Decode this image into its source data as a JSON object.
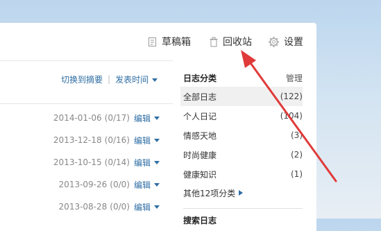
{
  "toolbar": {
    "drafts_label": "草稿箱",
    "recycle_label": "回收站",
    "settings_label": "设置"
  },
  "sort_bar": {
    "switch_label": "切换到摘要",
    "separator": "|",
    "sort_label": "发表时间"
  },
  "posts": [
    {
      "date": "2014-01-06",
      "stats": "(0/17)",
      "edit": "编辑"
    },
    {
      "date": "2013-12-18",
      "stats": "(0/16)",
      "edit": "编辑"
    },
    {
      "date": "2013-10-15",
      "stats": "(0/14)",
      "edit": "编辑"
    },
    {
      "date": "2013-09-26",
      "stats": "(0/0)",
      "edit": "编辑"
    },
    {
      "date": "2013-08-28",
      "stats": "(0/0)",
      "edit": "编辑"
    }
  ],
  "sidebar": {
    "title": "日志分类",
    "manage_label": "管理",
    "categories": [
      {
        "name": "全部日志",
        "count": "(122)"
      },
      {
        "name": "个人日记",
        "count": "(104)"
      },
      {
        "name": "情感天地",
        "count": "(3)"
      },
      {
        "name": "时尚健康",
        "count": "(2)"
      },
      {
        "name": "健康知识",
        "count": "(1)"
      }
    ],
    "more_label": "其他12项分类",
    "next_section": "搜索日志"
  },
  "colors": {
    "link": "#2e6da4",
    "annotation_arrow": "#e03a3a"
  }
}
